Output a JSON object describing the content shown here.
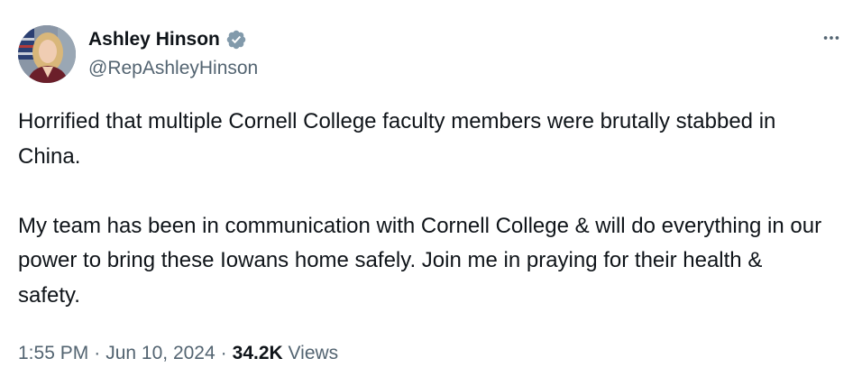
{
  "author": {
    "display_name": "Ashley Hinson",
    "handle": "@RepAshleyHinson",
    "verified": true,
    "badge_color": "#829aab"
  },
  "tweet": {
    "paragraphs": [
      "Horrified that multiple Cornell College faculty members were brutally stabbed in China.",
      "My team has been in communication with Cornell College & will do everything in our power to bring these Iowans home safely. Join me in praying for their health & safety."
    ]
  },
  "meta": {
    "time": "1:55 PM",
    "separator": "·",
    "date": "Jun 10, 2024",
    "views_count": "34.2K",
    "views_label": "Views"
  },
  "icons": {
    "more": "more-horizontal-icon",
    "verified": "verified-badge-icon"
  }
}
